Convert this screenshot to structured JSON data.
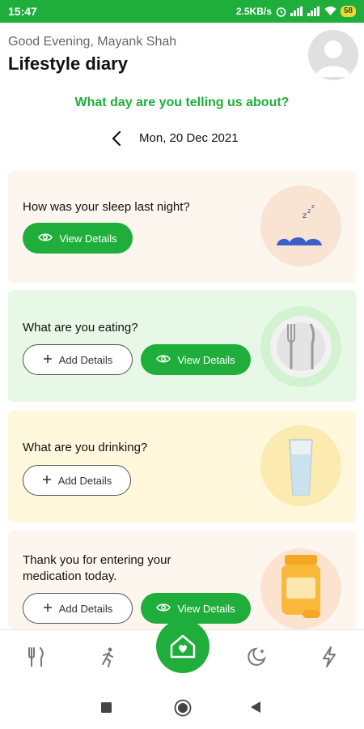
{
  "status_bar": {
    "time": "15:47",
    "network_speed": "2.5KB/s",
    "battery_level": "58"
  },
  "header": {
    "greeting": "Good Evening, Mayank Shah",
    "title": "Lifestyle diary",
    "avatar_icon": "user-avatar-icon"
  },
  "prompt": "What day are you telling us about?",
  "date_selector": {
    "back_icon": "chevron-left-icon",
    "date": "Mon, 20 Dec 2021"
  },
  "cards": [
    {
      "question": "How was your sleep last night?",
      "view_label": "View Details",
      "background": "#fdf6ee",
      "circle": "#f9e4d3"
    },
    {
      "question": "What are you eating?",
      "add_label": "Add Details",
      "view_label": "View Details",
      "background": "#e8f8e6",
      "circle": "#d3f2d0"
    },
    {
      "question": "What are you drinking?",
      "add_label": "Add Details",
      "background": "#fff8dc",
      "circle": "#fcebb0"
    },
    {
      "question": "Thank you for entering your medication today.",
      "add_label": "Add Details",
      "view_label": "View Details",
      "background": "#fdf6ee",
      "circle": "#fbe3d0"
    }
  ],
  "bottom_nav": {
    "items": [
      "food-icon",
      "activity-icon",
      "home-icon",
      "sleep-icon",
      "energy-icon"
    ]
  },
  "colors": {
    "accent": "#1fae3b"
  }
}
